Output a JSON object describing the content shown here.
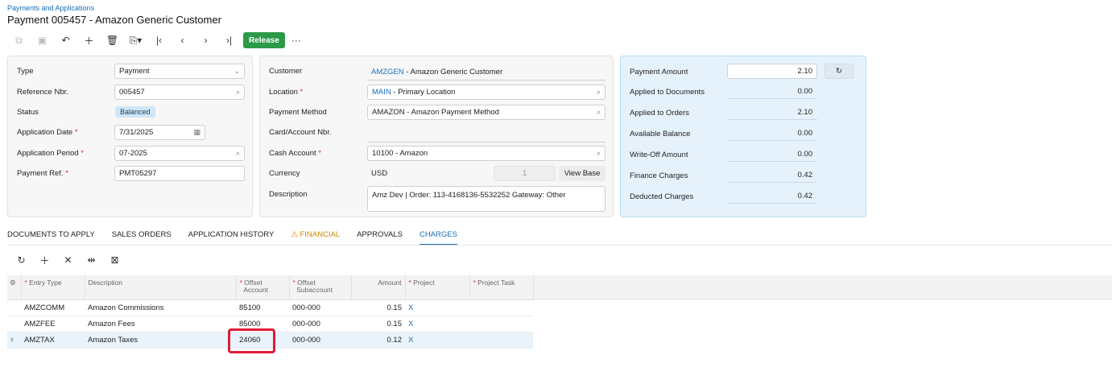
{
  "breadcrumb": "Payments and Applications",
  "title": "Payment 005457 - Amazon Generic Customer",
  "toolbar": {
    "release_label": "Release",
    "more_label": "···"
  },
  "left_form": {
    "type_label": "Type",
    "type_value": "Payment",
    "ref_label": "Reference Nbr.",
    "ref_value": "005457",
    "status_label": "Status",
    "status_value": "Balanced",
    "app_date_label": "Application Date",
    "app_date_value": "7/31/2025",
    "app_period_label": "Application Period",
    "app_period_value": "07-2025",
    "pay_ref_label": "Payment Ref.",
    "pay_ref_value": "PMT05297"
  },
  "mid_form": {
    "customer_label": "Customer",
    "customer_code": "AMZGEN",
    "customer_name": " - Amazon Generic Customer",
    "location_label": "Location",
    "location_code": "MAIN",
    "location_name": " - Primary Location",
    "pay_method_label": "Payment Method",
    "pay_method_value": "AMAZON - Amazon Payment Method",
    "card_label": "Card/Account Nbr.",
    "cash_acct_label": "Cash Account",
    "cash_acct_value": "10100 - Amazon",
    "currency_label": "Currency",
    "currency_value": "USD",
    "currency_rate": "1",
    "view_base_label": "View Base",
    "description_label": "Description",
    "description_value": "Amz Dev | Order: 113-4168136-5532252 Gateway: Other"
  },
  "right_form": {
    "payment_amount_label": "Payment Amount",
    "payment_amount_value": "2.10",
    "applied_docs_label": "Applied to Documents",
    "applied_docs_value": "0.00",
    "applied_orders_label": "Applied to Orders",
    "applied_orders_value": "2.10",
    "available_label": "Available Balance",
    "available_value": "0.00",
    "writeoff_label": "Write-Off Amount",
    "writeoff_value": "0.00",
    "finance_label": "Finance Charges",
    "finance_value": "0.42",
    "deducted_label": "Deducted Charges",
    "deducted_value": "0.42"
  },
  "tabs": [
    {
      "label": "DOCUMENTS TO APPLY"
    },
    {
      "label": "SALES ORDERS"
    },
    {
      "label": "APPLICATION HISTORY"
    },
    {
      "label": "FINANCIAL"
    },
    {
      "label": "APPROVALS"
    },
    {
      "label": "CHARGES"
    }
  ],
  "grid": {
    "headers": {
      "entry_type": "Entry Type",
      "description": "Description",
      "offset_account_1": "Offset",
      "offset_account_2": "Account",
      "offset_sub_1": "Offset",
      "offset_sub_2": "Subaccount",
      "amount": "Amount",
      "project": "Project",
      "project_task": "Project Task"
    },
    "rows": [
      {
        "entry_type": "AMZCOMM",
        "description": "Amazon Commissions",
        "account": "85100",
        "sub": "000-000",
        "amount": "0.15",
        "project": "X"
      },
      {
        "entry_type": "AMZFEE",
        "description": "Amazon Fees",
        "account": "85000",
        "sub": "000-000",
        "amount": "0.15",
        "project": "X"
      },
      {
        "entry_type": "AMZTAX",
        "description": "Amazon Taxes",
        "account": "24060",
        "sub": "000-000",
        "amount": "0.12",
        "project": "X"
      }
    ]
  }
}
